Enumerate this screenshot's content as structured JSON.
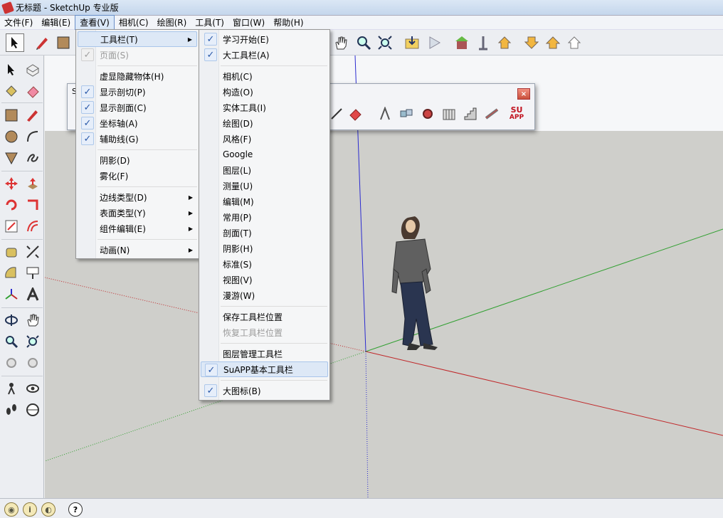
{
  "window": {
    "title": "无标题 - SketchUp 专业版"
  },
  "menubar": [
    "文件(F)",
    "编辑(E)",
    "查看(V)",
    "相机(C)",
    "绘图(R)",
    "工具(T)",
    "窗口(W)",
    "帮助(H)"
  ],
  "view_menu": {
    "items": [
      {
        "label": "工具栏(T)",
        "checked": false,
        "submenu": true,
        "highlighted": true
      },
      {
        "label": "页面(S)",
        "checked": true,
        "disabled": true
      },
      {
        "label": "虚显隐藏物体(H)",
        "checked": false
      },
      {
        "label": "显示剖切(P)",
        "checked": true
      },
      {
        "label": "显示剖面(C)",
        "checked": true
      },
      {
        "label": "坐标轴(A)",
        "checked": true
      },
      {
        "label": "辅助线(G)",
        "checked": true
      },
      {
        "label": "阴影(D)",
        "checked": false
      },
      {
        "label": "雾化(F)",
        "checked": false
      },
      {
        "label": "边线类型(D)",
        "submenu": true
      },
      {
        "label": "表面类型(Y)",
        "submenu": true
      },
      {
        "label": "组件编辑(E)",
        "submenu": true
      },
      {
        "label": "动画(N)",
        "submenu": true
      }
    ]
  },
  "toolbars_submenu": {
    "items": [
      {
        "label": "学习开始(E)",
        "checked": true
      },
      {
        "label": "大工具栏(A)",
        "checked": true
      },
      {
        "label": "相机(C)"
      },
      {
        "label": "构造(O)"
      },
      {
        "label": "实体工具(I)"
      },
      {
        "label": "绘图(D)"
      },
      {
        "label": "风格(F)"
      },
      {
        "label": "Google"
      },
      {
        "label": "图层(L)"
      },
      {
        "label": "测量(U)"
      },
      {
        "label": "编辑(M)"
      },
      {
        "label": "常用(P)"
      },
      {
        "label": "剖面(T)"
      },
      {
        "label": "阴影(H)"
      },
      {
        "label": "标准(S)"
      },
      {
        "label": "视图(V)"
      },
      {
        "label": "漫游(W)"
      },
      {
        "label": "保存工具栏位置"
      },
      {
        "label": "恢复工具栏位置",
        "disabled": true
      },
      {
        "label": "图层管理工具栏"
      },
      {
        "label": "SuAPP基本工具栏",
        "checked": true,
        "highlighted": true
      },
      {
        "label": "大图标(B)",
        "checked": true
      }
    ]
  },
  "floating_toolbar": {
    "title": "S",
    "logo_line1": "SU",
    "logo_line2": "APP"
  },
  "icons": {
    "select": "select-arrow-icon",
    "pencil": "pencil-icon",
    "help": "help-icon"
  },
  "statusbar": {
    "help_glyph": "?"
  },
  "colors": {
    "axis_red": "#c0282a",
    "axis_green": "#32a032",
    "axis_blue": "#2b2bd0",
    "highlight": "#dde8f6"
  }
}
